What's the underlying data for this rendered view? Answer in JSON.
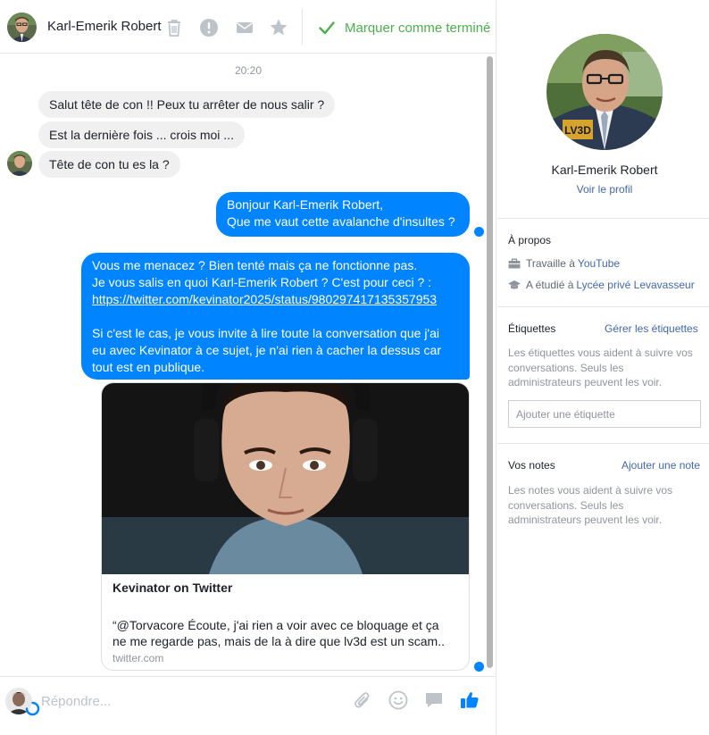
{
  "header": {
    "contact_name": "Karl-Emerik Robert",
    "mark_done_label": "Marquer comme terminé",
    "icons": [
      "trash-icon",
      "alert-icon",
      "mail-icon",
      "star-icon",
      "checkmark-icon"
    ]
  },
  "thread": {
    "timestamp": "20:20",
    "incoming": [
      {
        "text": "Salut tête de con !! Peux tu arrêter de nous salir ?"
      },
      {
        "text": "Est la dernière fois ... crois moi ..."
      },
      {
        "text": "Tête de con tu es la ?"
      }
    ],
    "outgoing_1": {
      "line1": "Bonjour Karl-Emerik Robert,",
      "line2": "Que me vaut cette avalanche d'insultes ?"
    },
    "outgoing_2": {
      "line1": "Vous me menacez ? Bien tenté mais ça ne fonctionne pas.",
      "line2": "Je vous salis en quoi Karl-Emerik Robert ? C'est pour ceci ? :",
      "link": "https://twitter.com/kevinator2025/status/980297417135357953",
      "line3": "Si c'est le cas, je vous invite à lire toute la conversation que j'ai",
      "line4": "eu avec Kevinator à ce sujet, je n'ai rien à cacher la dessus car",
      "line5": "tout est en publique."
    },
    "link_card": {
      "title": "Kevinator on Twitter",
      "desc_line1": "“@Torvacore Écoute, j'ai rien a voir avec ce bloquage et ça",
      "desc_line2": "ne me regarde pas, mais de la à dire que lv3d est un scam..",
      "domain": "twitter.com"
    }
  },
  "composer": {
    "placeholder": "Répondre...",
    "icons": [
      "attach-icon",
      "emoji-icon",
      "sticker-icon",
      "thumbs-up-icon"
    ]
  },
  "sidebar": {
    "name": "Karl-Emerik Robert",
    "view_profile": "Voir le profil",
    "about_title": "À propos",
    "work_prefix": "Travaille à",
    "work_place": "YouTube",
    "study_prefix": "A étudié à",
    "study_place": "Lycée privé Levavasseur",
    "tags_title": "Étiquettes",
    "tags_manage": "Gérer les étiquettes",
    "tags_help_1": "Les étiquettes vous aident à suivre vos",
    "tags_help_2": "conversations. Seuls les",
    "tags_help_3": "administrateurs peuvent les voir.",
    "tag_placeholder": "Ajouter une étiquette",
    "notes_title": "Vos notes",
    "notes_add": "Ajouter une note",
    "notes_help_1": "Les notes vous aident à suivre vos",
    "notes_help_2": "conversations. Seuls les",
    "notes_help_3": "administrateurs peuvent les voir.",
    "logo_text": "LV3D"
  },
  "colors": {
    "accent": "#0084ff",
    "done_green": "#4bb04b",
    "link_blue": "#4267b2"
  }
}
